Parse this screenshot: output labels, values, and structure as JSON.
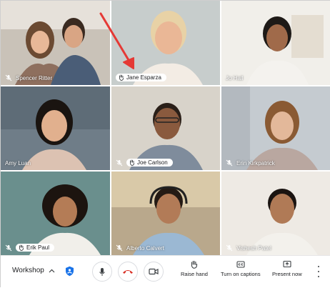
{
  "participants": [
    {
      "name": "Spencer Ritter",
      "hand_raised": false,
      "muted": true
    },
    {
      "name": "Jane Esparza",
      "hand_raised": true,
      "muted": false
    },
    {
      "name": "Jo Hall",
      "hand_raised": false,
      "muted": false
    },
    {
      "name": "Amy Luan",
      "hand_raised": false,
      "muted": false
    },
    {
      "name": "Joe Carlson",
      "hand_raised": true,
      "muted": true
    },
    {
      "name": "Erin Kirkpatrick",
      "hand_raised": false,
      "muted": true
    },
    {
      "name": "Erik Paul",
      "hand_raised": true,
      "muted": true
    },
    {
      "name": "Alberto Calvert",
      "hand_raised": false,
      "muted": true
    },
    {
      "name": "Vishesh Patel",
      "hand_raised": false,
      "muted": true
    }
  ],
  "toolbar": {
    "meeting_name": "Workshop",
    "raise_hand_label": "Raise hand",
    "captions_label": "Turn on captions",
    "present_label": "Present now"
  },
  "colors": {
    "hangup": "#d93025",
    "annotation_arrow": "#e53935",
    "shield": "#1a73e8"
  }
}
